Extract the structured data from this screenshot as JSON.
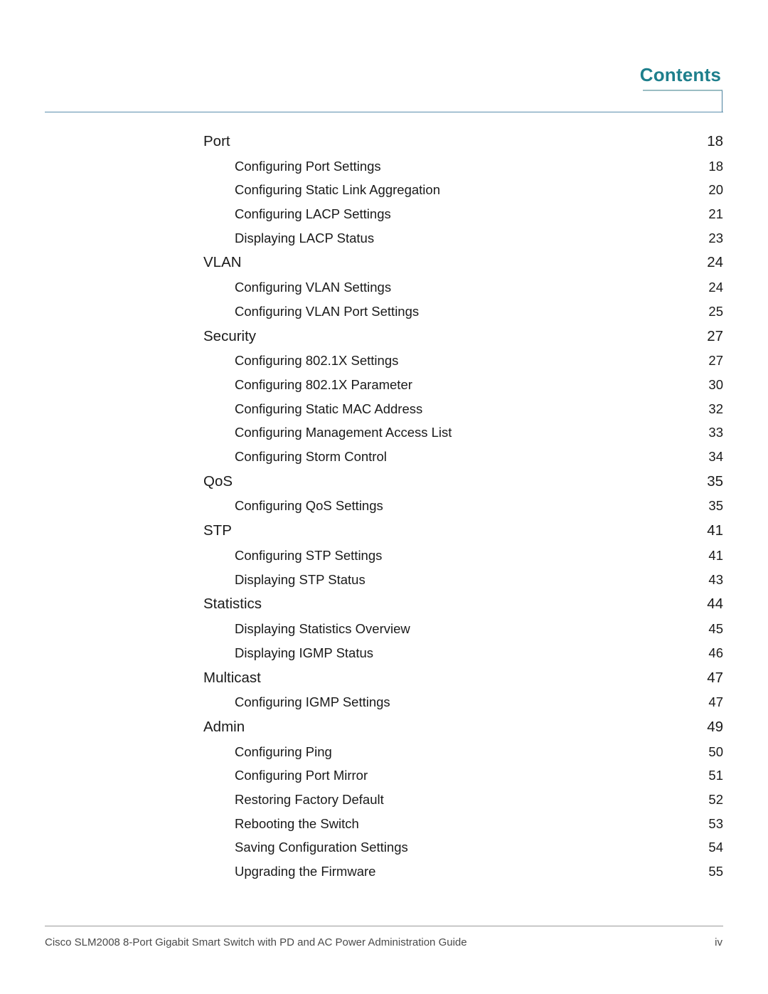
{
  "header": {
    "title": "Contents"
  },
  "toc": [
    {
      "type": "section",
      "label": "Port",
      "page": "18"
    },
    {
      "type": "sub",
      "label": "Configuring Port Settings",
      "page": "18"
    },
    {
      "type": "sub",
      "label": "Configuring Static Link Aggregation",
      "page": "20"
    },
    {
      "type": "sub",
      "label": "Configuring LACP Settings",
      "page": "21"
    },
    {
      "type": "sub",
      "label": "Displaying LACP Status",
      "page": "23"
    },
    {
      "type": "section",
      "label": "VLAN",
      "page": "24"
    },
    {
      "type": "sub",
      "label": "Configuring VLAN Settings",
      "page": "24"
    },
    {
      "type": "sub",
      "label": "Configuring VLAN Port Settings",
      "page": "25"
    },
    {
      "type": "section",
      "label": "Security",
      "page": "27"
    },
    {
      "type": "sub",
      "label": "Configuring 802.1X Settings",
      "page": "27"
    },
    {
      "type": "sub",
      "label": "Configuring 802.1X Parameter",
      "page": "30"
    },
    {
      "type": "sub",
      "label": "Configuring Static MAC Address",
      "page": "32"
    },
    {
      "type": "sub",
      "label": "Configuring Management Access List",
      "page": "33"
    },
    {
      "type": "sub",
      "label": "Configuring Storm Control",
      "page": "34"
    },
    {
      "type": "section",
      "label": "QoS",
      "page": "35"
    },
    {
      "type": "sub",
      "label": "Configuring QoS Settings",
      "page": "35"
    },
    {
      "type": "section",
      "label": "STP",
      "page": "41"
    },
    {
      "type": "sub",
      "label": "Configuring STP Settings",
      "page": "41"
    },
    {
      "type": "sub",
      "label": "Displaying STP Status",
      "page": "43"
    },
    {
      "type": "section",
      "label": "Statistics",
      "page": "44"
    },
    {
      "type": "sub",
      "label": "Displaying Statistics Overview",
      "page": "45"
    },
    {
      "type": "sub",
      "label": "Displaying IGMP Status",
      "page": "46"
    },
    {
      "type": "section",
      "label": "Multicast",
      "page": "47"
    },
    {
      "type": "sub",
      "label": "Configuring IGMP Settings",
      "page": "47"
    },
    {
      "type": "section",
      "label": "Admin",
      "page": "49"
    },
    {
      "type": "sub",
      "label": "Configuring Ping",
      "page": "50"
    },
    {
      "type": "sub",
      "label": "Configuring Port Mirror",
      "page": "51"
    },
    {
      "type": "sub",
      "label": "Restoring Factory Default",
      "page": "52"
    },
    {
      "type": "sub",
      "label": "Rebooting the Switch",
      "page": "53"
    },
    {
      "type": "sub",
      "label": "Saving Configuration Settings",
      "page": "54"
    },
    {
      "type": "sub",
      "label": "Upgrading the Firmware",
      "page": "55"
    }
  ],
  "footer": {
    "text": "Cisco SLM2008 8-Port Gigabit Smart Switch with PD and AC Power Administration Guide",
    "page": "iv"
  }
}
